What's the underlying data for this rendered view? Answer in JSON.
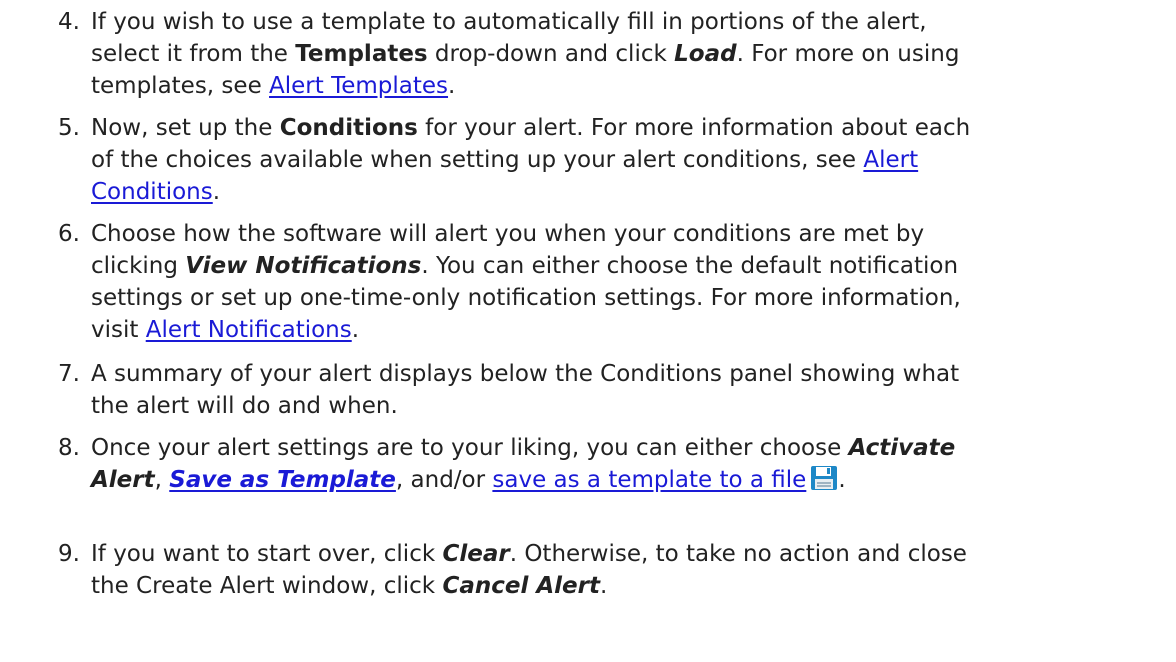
{
  "steps": [
    {
      "number": "4.",
      "l1": "If you wish to use a template to automatically fill in portions of the alert,",
      "l2a": "select it from the ",
      "l2b": "Templates",
      "l2c": " drop-down and click ",
      "l2d": "Load",
      "l2e": ". For more on using",
      "l3a": "templates, see ",
      "l3link": "Alert Templates",
      "l3b": "."
    },
    {
      "number": "5.",
      "l1a": "Now, set up the ",
      "l1b": "Conditions",
      "l1c": " for your alert. For more information about each",
      "l2a": "of the choices available when setting up your alert conditions, see ",
      "link_line1": "Alert",
      "link_line2": "Conditions",
      "l3b": "."
    },
    {
      "number": "6.",
      "l1": "Choose how the software will alert you when your conditions are met by",
      "l2a": "clicking ",
      "l2b": "View Notifications",
      "l2c": ". You can either choose the default notification",
      "l3": "settings or set up one-time-only notification settings. For more information,",
      "l4a": "visit ",
      "l4link": "Alert Notifications",
      "l4b": "."
    },
    {
      "number": "7.",
      "l1": "A summary of your alert displays below the Conditions panel showing what",
      "l2": "the alert will do and when."
    },
    {
      "number": "8.",
      "l1a": "Once your alert settings are to your liking, you can either choose ",
      "l1b": "Activate",
      "l2a": "Alert",
      "l2b": ", ",
      "l2link": "Save as Template",
      "l2c": ", and/or ",
      "l2link2": "save as a template to a file",
      "l2d": ".",
      "icon": "save-file-icon",
      "icon_color": "#1e88c7"
    },
    {
      "number": "9.",
      "l1a": "If you want to start over, click ",
      "l1b": "Clear",
      "l1c": ". Otherwise, to take no action and close",
      "l2a": "the Create Alert window, click ",
      "l2b": "Cancel Alert",
      "l2c": "."
    }
  ],
  "colors": {
    "text": "#222222",
    "link": "#1a1ad6"
  }
}
